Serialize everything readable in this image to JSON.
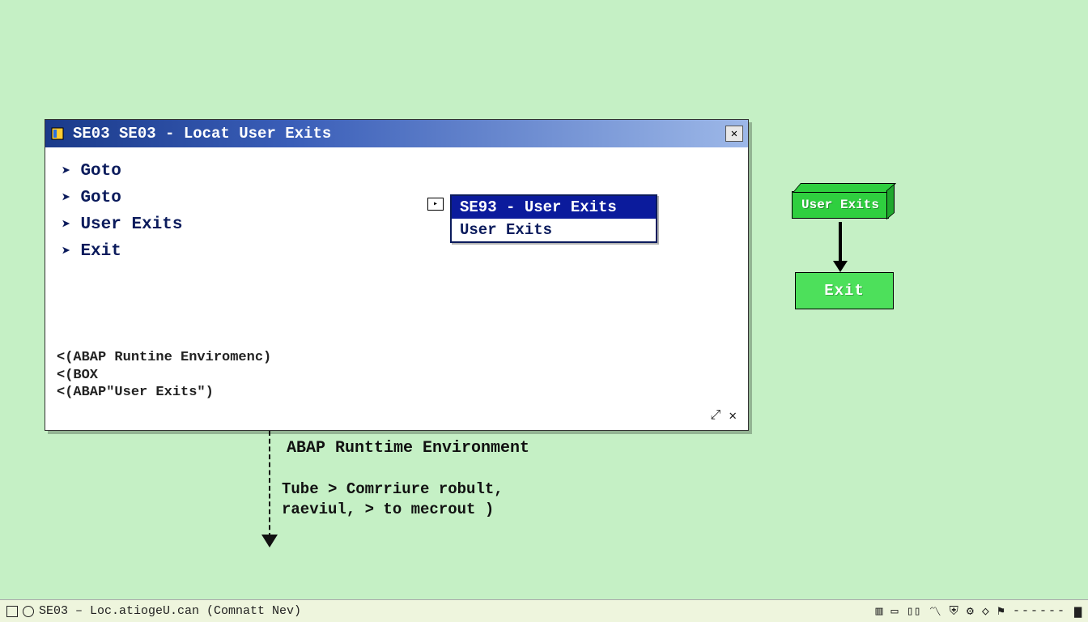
{
  "window": {
    "title": "SE03  SE03 - Locat User Exits",
    "menu": [
      {
        "label": "Goto"
      },
      {
        "label": "Goto"
      },
      {
        "label": "User Exits"
      },
      {
        "label": "Exit"
      }
    ],
    "dropdown": {
      "options": [
        {
          "label": "SE93 - User Exits",
          "selected": true
        },
        {
          "label": "User Exits",
          "selected": false
        }
      ]
    },
    "code": {
      "line1": "<(ABAP Runtine Enviromenc)",
      "line2": "<(BOX",
      "line3": "<(ABAP\"User Exits\")"
    }
  },
  "annotation": {
    "title": "ABAP Runttime Environment",
    "body": "Tube  > Comrriure robult, raeviul, > to mecrout )"
  },
  "diagram": {
    "box1": "User Exits",
    "box2": "Exit"
  },
  "taskbar": {
    "label": "SE03 – Loc.atiogeU.can (Comnatt Nev)",
    "sep": "------"
  }
}
